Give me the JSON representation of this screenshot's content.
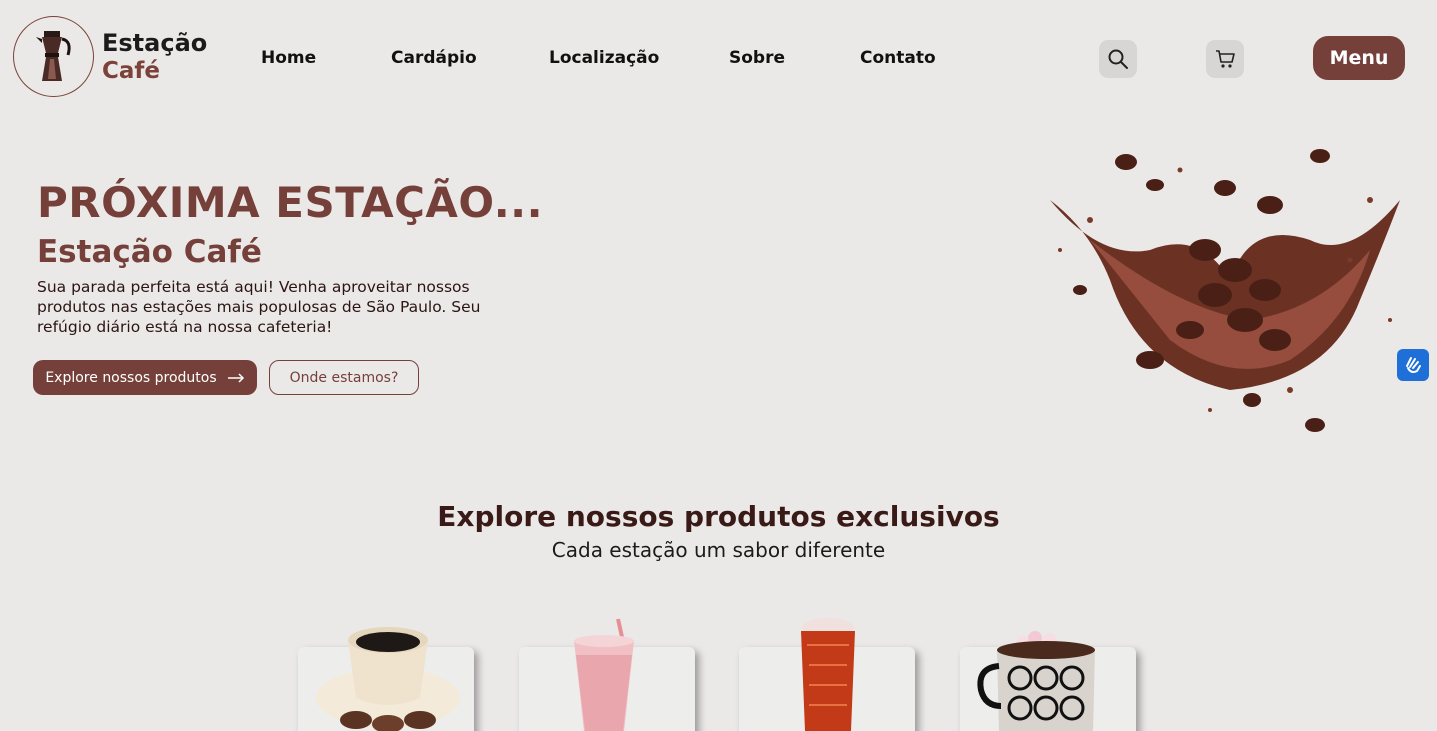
{
  "brand": {
    "line1": "Estação",
    "line2": "Café",
    "logo_icon": "moka-pot-icon",
    "color": "#76403a"
  },
  "nav": {
    "items": [
      {
        "label": "Home"
      },
      {
        "label": "Cardápio"
      },
      {
        "label": "Localização"
      },
      {
        "label": "Sobre"
      },
      {
        "label": "Contato"
      }
    ]
  },
  "header": {
    "search_icon": "search-icon",
    "cart_icon": "cart-icon",
    "menu_label": "Menu"
  },
  "hero": {
    "title": "PRÓXIMA ESTAÇÃO...",
    "subtitle": "Estação Café",
    "description": "Sua parada perfeita está aqui! Venha aproveitar nossos produtos nas estações mais populosas de São Paulo. Seu refúgio diário está na nossa cafeteria!",
    "primary_button": "Explore nossos produtos",
    "secondary_button": "Onde estamos?"
  },
  "accessibility": {
    "icon": "sign-language-icon",
    "color": "#1f6fd8"
  },
  "products": {
    "title": "Explore nossos produtos exclusivos",
    "subtitle": "Cada estação um sabor diferente",
    "cards": [
      {
        "image": "coffee-cup-with-cookies"
      },
      {
        "image": "pink-milkshake"
      },
      {
        "image": "iced-red-drink"
      },
      {
        "image": "hot-chocolate-mug-with-marshmallows"
      }
    ]
  }
}
